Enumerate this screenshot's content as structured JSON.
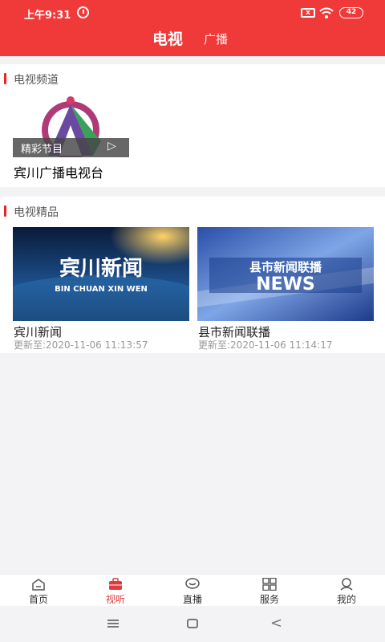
{
  "status_bar": {
    "time": "上午9:31",
    "battery": "42",
    "sim_badge": "x"
  },
  "header": {
    "tabs": [
      {
        "label": "电视",
        "active": true
      },
      {
        "label": "广播",
        "active": false
      }
    ],
    "accent_color": "#f03a3a"
  },
  "tv_channels": {
    "section_title": "电视频道",
    "channels": [
      {
        "name": "宾川广播电视台",
        "overlay_label": "精彩节目",
        "play_icon": "play-icon"
      }
    ]
  },
  "tv_highlights": {
    "section_title": "电视精品",
    "items": [
      {
        "title": "宾川新闻",
        "updated": "更新至:2020-11-06 11:13:57",
        "thumb_text": "宾川新闻",
        "thumb_subtext": "BIN CHUAN XIN WEN"
      },
      {
        "title": "县市新闻联播",
        "updated": "更新至:2020-11-06 11:14:17",
        "thumb_text": "县市新闻联播",
        "thumb_subtext": "NEWS"
      }
    ]
  },
  "bottom_nav": {
    "items": [
      {
        "label": "首页",
        "icon": "home-icon",
        "active": false
      },
      {
        "label": "视听",
        "icon": "tv-briefcase-icon",
        "active": true
      },
      {
        "label": "直播",
        "icon": "live-bubble-icon",
        "active": false
      },
      {
        "label": "服务",
        "icon": "grid-icon",
        "active": false
      },
      {
        "label": "我的",
        "icon": "user-icon",
        "active": false
      }
    ],
    "active_color": "#e23b3b"
  }
}
